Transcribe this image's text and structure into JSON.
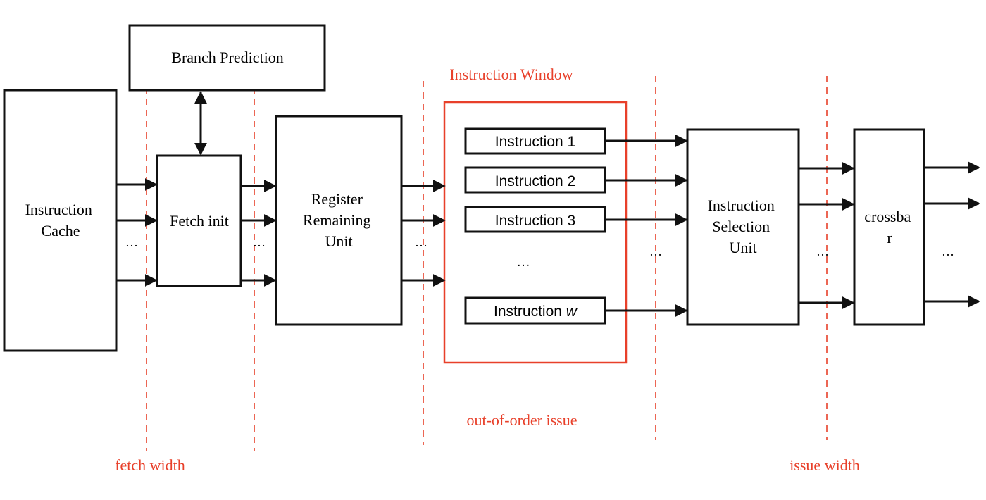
{
  "colors": {
    "accent_red": "#e8402a",
    "line": "#111111"
  },
  "blocks": {
    "instruction_cache": [
      "Instruction",
      "Cache"
    ],
    "branch_prediction": "Branch Prediction",
    "fetch_unit": "Fetch init",
    "register_unit": [
      "Register",
      "Remaining",
      "Unit"
    ],
    "selection_unit": [
      "Instruction",
      "Selection",
      "Unit"
    ],
    "crossbar": [
      "crossba",
      "r"
    ]
  },
  "window": {
    "title": "Instruction Window",
    "entries": [
      "Instruction 1",
      "Instruction 2",
      "Instruction 3"
    ],
    "last_entry_prefix": "Instruction",
    "last_entry_var": "w",
    "ellipsis": "…"
  },
  "ellipsis": "…",
  "annotations": {
    "fetch_width": "fetch width",
    "out_of_order": "out-of-order issue",
    "issue_width": "issue width"
  }
}
